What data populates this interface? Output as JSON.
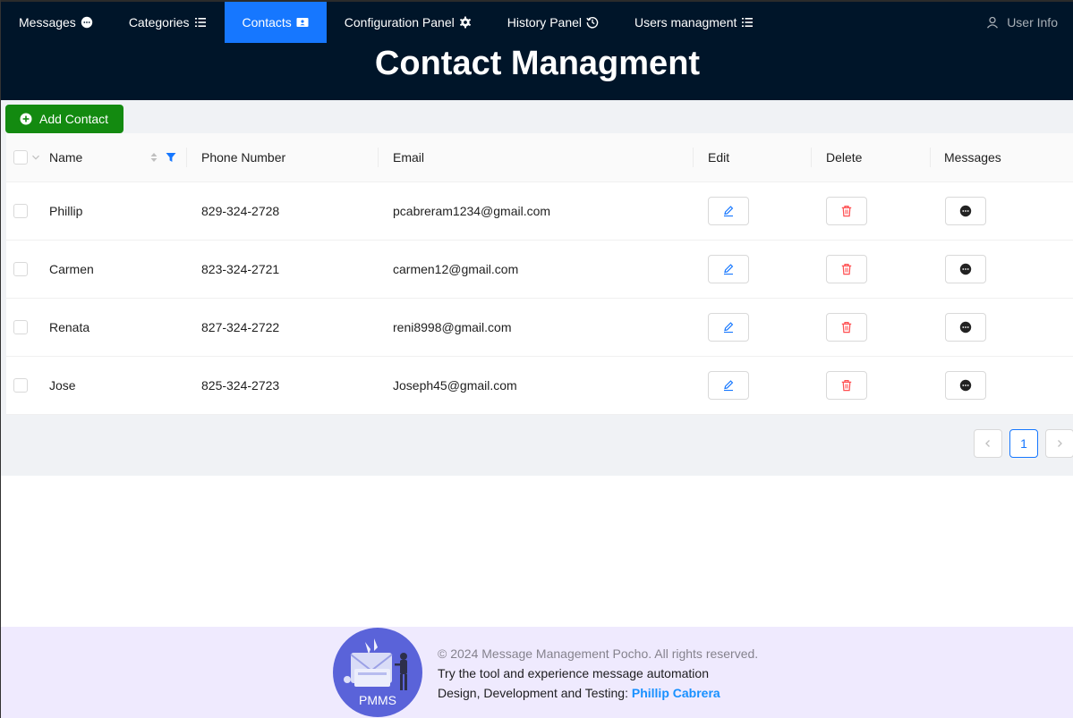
{
  "nav": {
    "items": [
      {
        "label": "Messages",
        "icon": "message-bubble-icon"
      },
      {
        "label": "Categories",
        "icon": "list-icon"
      },
      {
        "label": "Contacts",
        "icon": "contact-card-icon",
        "active": true
      },
      {
        "label": "Configuration Panel",
        "icon": "gear-icon"
      },
      {
        "label": "History Panel",
        "icon": "history-icon"
      },
      {
        "label": "Users managment",
        "icon": "list-icon"
      }
    ],
    "user_info": "User Info"
  },
  "header": {
    "title": "Contact Managment"
  },
  "toolbar": {
    "add_label": "Add Contact"
  },
  "table": {
    "columns": [
      "Name",
      "Phone Number",
      "Email",
      "Edit",
      "Delete",
      "Messages"
    ],
    "rows": [
      {
        "name": "Phillip",
        "phone": "829-324-2728",
        "email": "pcabreram1234@gmail.com"
      },
      {
        "name": "Carmen",
        "phone": "823-324-2721",
        "email": "carmen12@gmail.com"
      },
      {
        "name": "Renata",
        "phone": "827-324-2722",
        "email": "reni8998@gmail.com"
      },
      {
        "name": "Jose",
        "phone": "825-324-2723",
        "email": "Joseph45@gmail.com"
      }
    ]
  },
  "pagination": {
    "current": "1"
  },
  "footer": {
    "logo_text": "PMMS",
    "copyright": "© 2024 Message Management Pocho. All rights reserved.",
    "tagline": "Try the tool and experience message automation",
    "credits_prefix": "Design, Development and Testing: ",
    "author": "Phillip Cabrera"
  },
  "colors": {
    "header_bg": "#001529",
    "active_tab": "#1677ff",
    "add_button": "#138a10",
    "edit_icon": "#1677ff",
    "delete_icon": "#ff4d4f",
    "footer_bg": "#efeafe",
    "logo_bg": "#5a63d9"
  }
}
